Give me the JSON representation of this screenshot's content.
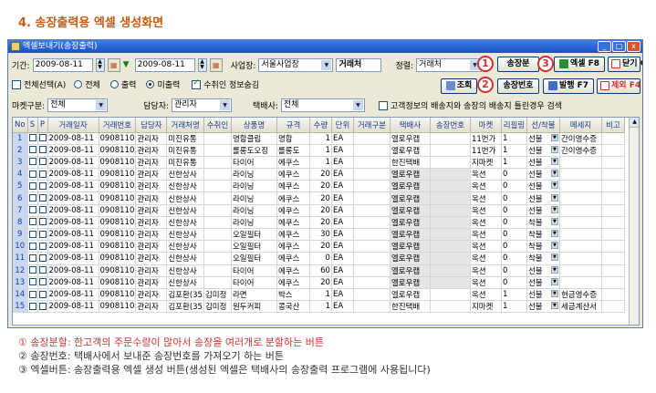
{
  "heading": "4. 송장출력용 엑셀 생성화면",
  "window": {
    "title": "엑셀보내기(송장출력)",
    "controls": {
      "min": "_",
      "max": "□",
      "close": "x"
    }
  },
  "filters": {
    "period_label": "기간:",
    "date_from": "2009-08-11",
    "date_to": "2009-08-11",
    "biz_label": "사업장:",
    "biz_value": "서울사업장",
    "sort_field": "거래처",
    "order_label": "정렬:",
    "order_value": "거래처",
    "select_all_label": "전체선택(A)",
    "radio_all": "전체",
    "radio_printed": "출력",
    "radio_unprinted": "미출력",
    "receiver_label": "수취인 정보숨김",
    "market_label": "마켓구분:",
    "market_value": "전체",
    "manager_label": "담당자:",
    "manager_value": "관리자",
    "carrier_label": "택배사:",
    "carrier_value": "전체",
    "addr_check_label": "고객정보의 배송지와 송장의 배송지 틀린경우 검색"
  },
  "buttons": {
    "search": "조회",
    "split": "송장분",
    "excel": "엑셀 F8",
    "close": "닫기 C",
    "tracking": "송장번호",
    "new": "발행 F7",
    "exclude": "제외 F4"
  },
  "markers": {
    "one": "1",
    "two": "2",
    "three": "3"
  },
  "table": {
    "headers": [
      "No",
      "S",
      "P",
      "거래일자",
      "거래번호",
      "담당자",
      "거래처명",
      "수취인",
      "상품명",
      "규격",
      "수량",
      "단위",
      "거래구분",
      "택배사",
      "송장번호",
      "마켓",
      "리필링",
      "선/착불",
      "메세지",
      "비고"
    ],
    "rows": [
      [
        "1",
        "",
        "",
        "2009-08-11",
        "0908110",
        "관리자",
        "미진유통",
        "",
        "명함클립",
        "명함",
        "1",
        "EA",
        "",
        "엘로우캡",
        "",
        "11번가",
        "1",
        "선불",
        "간이영수증"
      ],
      [
        "2",
        "",
        "",
        "2009-08-11",
        "0908110",
        "관리자",
        "미진유통",
        "",
        "롤롱도오징",
        "롤롱도",
        "1",
        "EA",
        "",
        "엘로우캡",
        "",
        "11번가",
        "1",
        "선불",
        "간이영수증"
      ],
      [
        "3",
        "",
        "",
        "2009-08-11",
        "0908110",
        "관리자",
        "미진유통",
        "",
        "타이어",
        "에쿠스",
        "1",
        "EA",
        "",
        "한진택배",
        "",
        "지마켓",
        "1",
        "선불",
        ""
      ],
      [
        "4",
        "",
        "",
        "2009-08-11",
        "0908110",
        "관리자",
        "신한상사",
        "",
        "라이닝",
        "에쿠스",
        "20",
        "EA",
        "",
        "엘로우캡",
        "",
        "옥션",
        "0",
        "선불",
        ""
      ],
      [
        "5",
        "",
        "",
        "2009-08-11",
        "0908110",
        "관리자",
        "신한상사",
        "",
        "라이닝",
        "에쿠스",
        "20",
        "EA",
        "",
        "엘로우캡",
        "",
        "옥션",
        "0",
        "선불",
        ""
      ],
      [
        "6",
        "",
        "",
        "2009-08-11",
        "0908110",
        "관리자",
        "신한상사",
        "",
        "라이닝",
        "에쿠스",
        "20",
        "EA",
        "",
        "엘로우캡",
        "",
        "옥션",
        "0",
        "선불",
        ""
      ],
      [
        "7",
        "",
        "",
        "2009-08-11",
        "0908110",
        "관리자",
        "신한상사",
        "",
        "라이닝",
        "에쿠스",
        "20",
        "EA",
        "",
        "엘로우캡",
        "",
        "옥션",
        "0",
        "선불",
        ""
      ],
      [
        "8",
        "",
        "",
        "2009-08-11",
        "0908110",
        "관리자",
        "신한상사",
        "",
        "라이닝",
        "에쿠스",
        "20",
        "EA",
        "",
        "엘로우캡",
        "",
        "옥션",
        "0",
        "착불",
        ""
      ],
      [
        "9",
        "",
        "",
        "2009-08-11",
        "0908110",
        "관리자",
        "신한상사",
        "",
        "오일필터",
        "에쿠스",
        "30",
        "EA",
        "",
        "엘로우캡",
        "",
        "옥션",
        "0",
        "착불",
        ""
      ],
      [
        "10",
        "",
        "",
        "2009-08-11",
        "0908110",
        "관리자",
        "신한상사",
        "",
        "오일필터",
        "에쿠스",
        "20",
        "EA",
        "",
        "엘로우캡",
        "",
        "옥션",
        "0",
        "착불",
        ""
      ],
      [
        "11",
        "",
        "",
        "2009-08-11",
        "0908110",
        "관리자",
        "신한상사",
        "",
        "오일필터",
        "에쿠스",
        "0",
        "EA",
        "",
        "엘로우캡",
        "",
        "옥션",
        "0",
        "착불",
        ""
      ],
      [
        "12",
        "",
        "",
        "2009-08-11",
        "0908110",
        "관리자",
        "신한상사",
        "",
        "타이어",
        "에쿠스",
        "60",
        "EA",
        "",
        "엘로우캡",
        "",
        "옥션",
        "0",
        "선불",
        ""
      ],
      [
        "13",
        "",
        "",
        "2009-08-11",
        "0908110",
        "관리자",
        "신한상사",
        "",
        "타이어",
        "에쿠스",
        "20",
        "EA",
        "",
        "엘로우캡",
        "",
        "옥션",
        "0",
        "선불",
        ""
      ],
      [
        "14",
        "",
        "",
        "2009-08-11",
        "0908110",
        "관리자",
        "김포환(35",
        "김미정",
        "라면",
        "박스",
        "1",
        "EA",
        "",
        "엘로우캡",
        "",
        "옥션",
        "1",
        "선불",
        "현금영수증"
      ],
      [
        "15",
        "",
        "",
        "2009-08-11",
        "0908110",
        "관리자",
        "김포환(35",
        "김미정",
        "원두커피",
        "콩국산",
        "1",
        "EA",
        "",
        "한진택배",
        "",
        "지마켓",
        "1",
        "선불",
        "세금계산서"
      ]
    ]
  },
  "notes": [
    "① 송장분할: 한고객의 주문수량이 많아서 송장을 여러개로 분할하는 버튼",
    "② 송장번호: 택배사에서 보내준 송장번호를 가져오기 하는 버튼",
    "③ 엑셀버튼: 송장출력용 엑셀 생성 버튼(생성된 엑셀은 택배사의 송장출력 프로그램에 사용됩니다)"
  ]
}
